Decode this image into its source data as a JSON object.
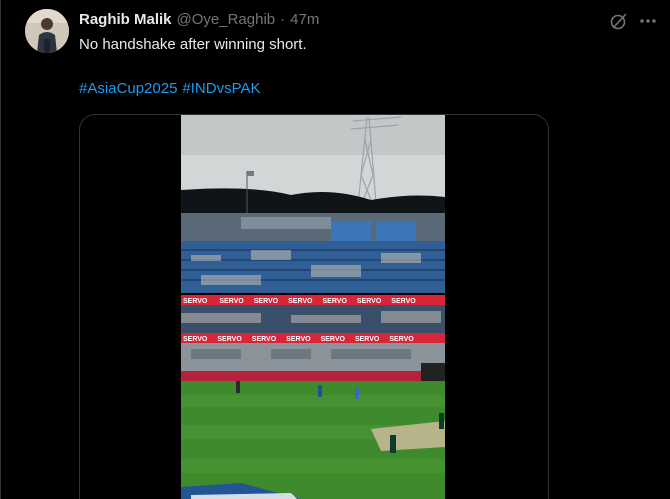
{
  "tweet": {
    "author": {
      "display_name": "Raghib Malik",
      "handle": "@Oye_Raghib",
      "separator": "·",
      "time": "47m"
    },
    "text": "No handshake after winning short.",
    "hashtags": [
      "#AsiaCup2025",
      "#INDvsPAK"
    ],
    "actions": {
      "grok_icon": "grok-icon",
      "more_icon": "more-options-icon"
    },
    "media": {
      "type": "video",
      "ad_board_text": "SERVO",
      "colors": {
        "accent_link": "#1d9bf0",
        "grass": "#3f8a2c",
        "seats": "#2f5f95",
        "ad_board": "#d8253a"
      }
    }
  }
}
